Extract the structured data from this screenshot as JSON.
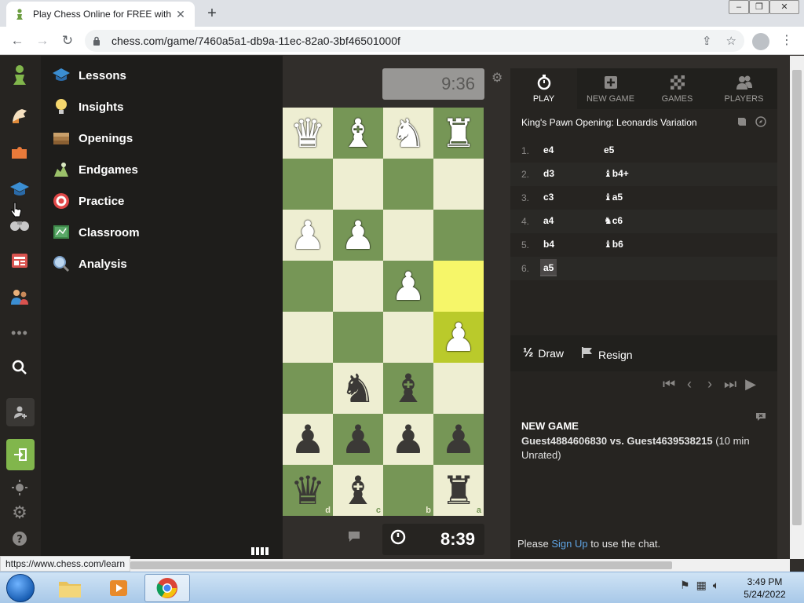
{
  "browser": {
    "tab_title": "Play Chess Online for FREE with F",
    "new_tab_label": "+",
    "url": "chess.com/game/7460a5a1-db9a-11ec-82a0-3bf46501000f",
    "status_url": "https://www.chess.com/learn"
  },
  "window_controls": {
    "minimize": "–",
    "maximize": "❐",
    "close": "✕"
  },
  "learn_menu": {
    "items": [
      {
        "label": "Lessons",
        "icon": "lessons-icon"
      },
      {
        "label": "Insights",
        "icon": "insights-icon"
      },
      {
        "label": "Openings",
        "icon": "openings-icon"
      },
      {
        "label": "Endgames",
        "icon": "endgames-icon"
      },
      {
        "label": "Practice",
        "icon": "practice-icon"
      },
      {
        "label": "Classroom",
        "icon": "classroom-icon"
      },
      {
        "label": "Analysis",
        "icon": "analysis-icon"
      }
    ]
  },
  "clocks": {
    "top": "9:36",
    "bottom": "8:39"
  },
  "board": {
    "files": [
      "d",
      "c",
      "b",
      "a"
    ],
    "highlight_colors": {
      "light": "#f6f669",
      "dark": "#baca2b"
    }
  },
  "panel": {
    "tabs": [
      {
        "label": "PLAY",
        "icon": "stopwatch-icon",
        "active": true
      },
      {
        "label": "NEW GAME",
        "icon": "plus-icon",
        "active": false
      },
      {
        "label": "GAMES",
        "icon": "board-icon",
        "active": false
      },
      {
        "label": "PLAYERS",
        "icon": "players-icon",
        "active": false
      }
    ],
    "opening": "King's Pawn Opening: Leonardis Variation",
    "moves": [
      {
        "num": "1.",
        "white": "e4",
        "black": "e5"
      },
      {
        "num": "2.",
        "white": "d3",
        "black": "♝b4+"
      },
      {
        "num": "3.",
        "white": "c3",
        "black": "♝a5"
      },
      {
        "num": "4.",
        "white": "a4",
        "black": "♞c6"
      },
      {
        "num": "5.",
        "white": "b4",
        "black": "♝b6"
      },
      {
        "num": "6.",
        "white": "a5",
        "black": ""
      }
    ],
    "draw_icon": "½",
    "draw_label": "Draw",
    "resign_label": "Resign",
    "nav_controls": [
      "⏮",
      "‹",
      "›",
      "⏭",
      "▶"
    ],
    "chat": {
      "title": "NEW GAME",
      "players": "Guest4884606830 vs. Guest4639538215",
      "detail": " (10 min Unrated)",
      "please": "Please ",
      "signup": "Sign Up",
      "rest": " to use the chat."
    }
  },
  "taskbar": {
    "time": "3:49 PM",
    "date": "5/24/2022"
  },
  "colors": {
    "board_light": "#eeeed2",
    "board_dark": "#769656",
    "bg": "#312e2b",
    "link": "#5fa4e4"
  }
}
